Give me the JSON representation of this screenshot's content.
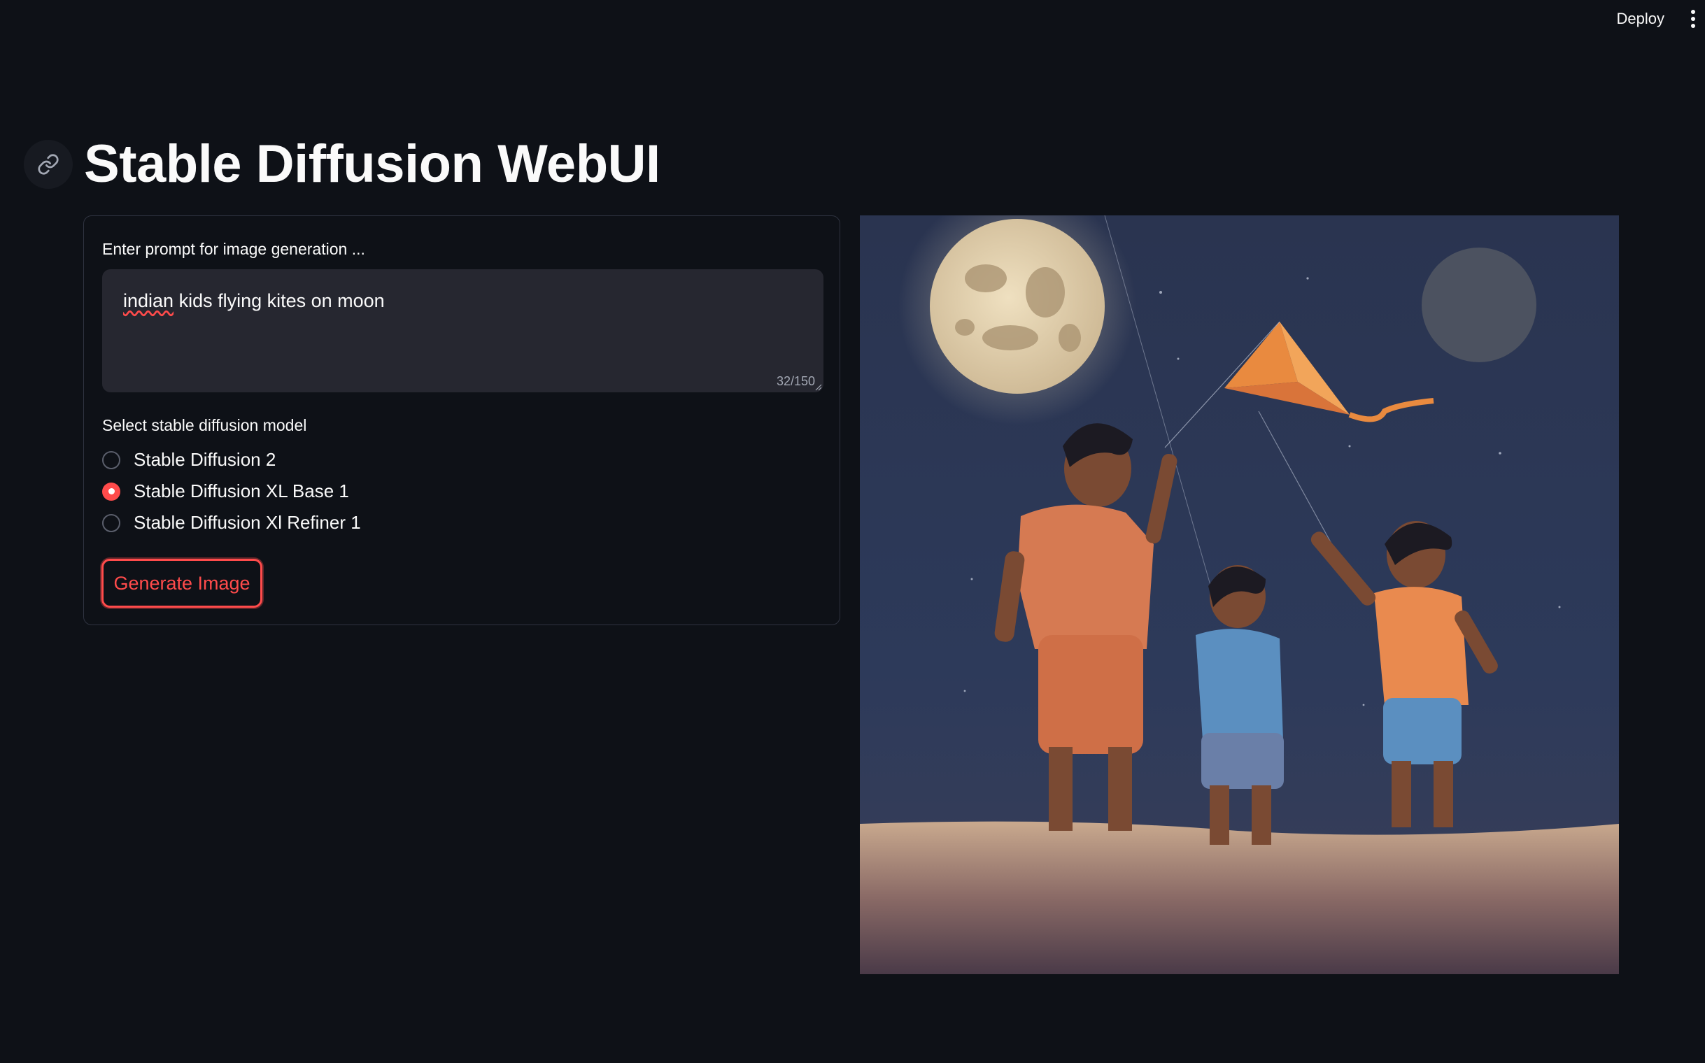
{
  "header": {
    "deploy_label": "Deploy"
  },
  "page": {
    "title": "Stable Diffusion WebUI"
  },
  "form": {
    "prompt_label": "Enter prompt for image generation ...",
    "prompt_value_word1": "indian",
    "prompt_value_rest": " kids flying kites on moon",
    "char_counter": "32/150",
    "model_label": "Select stable diffusion model",
    "models": [
      {
        "label": "Stable Diffusion 2",
        "selected": false
      },
      {
        "label": "Stable Diffusion XL Base 1",
        "selected": true
      },
      {
        "label": "Stable Diffusion Xl Refiner 1",
        "selected": false
      }
    ],
    "generate_label": "Generate Image"
  },
  "colors": {
    "background": "#0e1117",
    "accent": "#ff4b4b",
    "input_bg": "#262730",
    "border": "#2f3340"
  },
  "icons": {
    "anchor": "link-icon",
    "menu": "more-vertical-icon"
  }
}
